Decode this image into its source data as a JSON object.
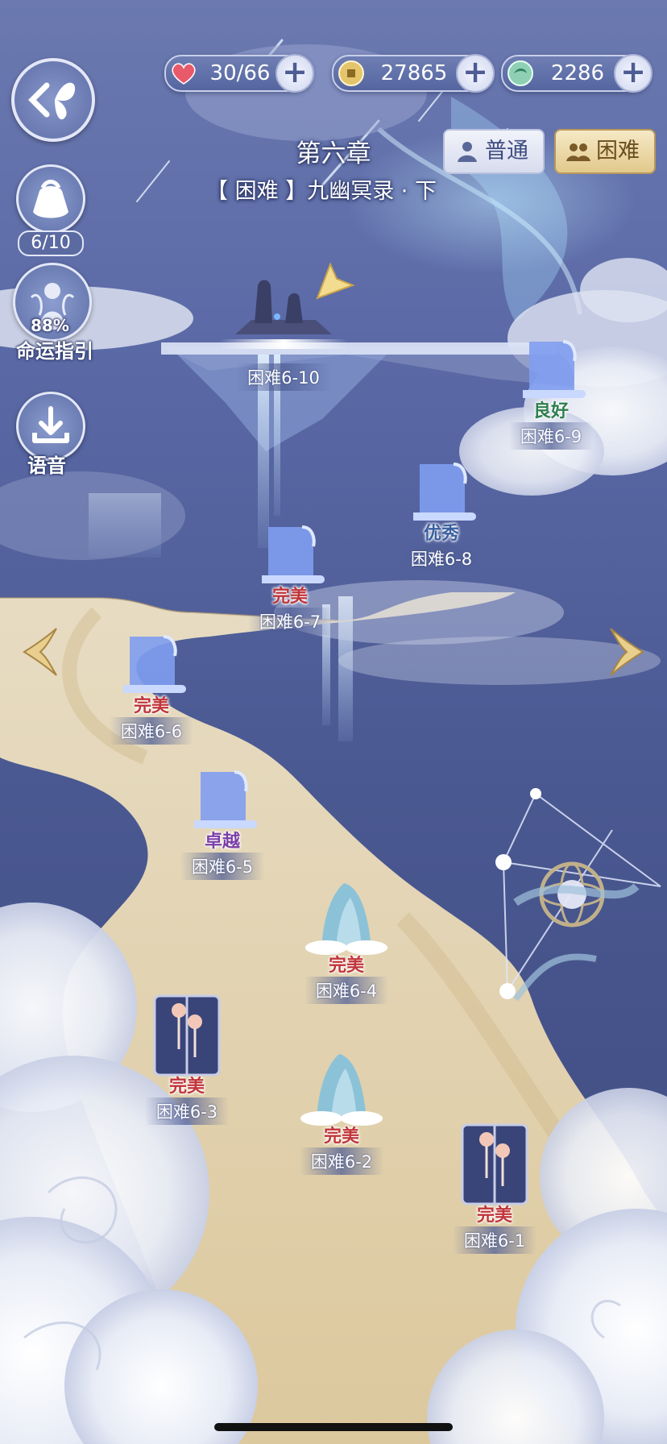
{
  "resources": {
    "stamina": {
      "value": "30/66",
      "icon": "heart-icon",
      "color": "#e8596a"
    },
    "coins": {
      "value": "27865",
      "icon": "coin-icon",
      "color": "#d9b65a"
    },
    "gems": {
      "value": "2286",
      "icon": "jade-icon",
      "color": "#7fc3a8"
    }
  },
  "chapter": {
    "title": "第六章",
    "subtitle": "【 困难 】九幽冥录 · 下"
  },
  "modes": {
    "normal": "普通",
    "hard": "困难",
    "selected": "hard"
  },
  "side": {
    "bag_count": "6/10",
    "fate_percent": "88%",
    "fate_label": "命运指引",
    "voice_label": "语音"
  },
  "stages": [
    {
      "name": "困难6-10",
      "grade": "",
      "type": "mountain-peak"
    },
    {
      "name": "困难6-9",
      "grade": "良好",
      "type": "scroll"
    },
    {
      "name": "困难6-8",
      "grade": "优秀",
      "type": "scroll"
    },
    {
      "name": "困难6-7",
      "grade": "完美",
      "type": "scroll"
    },
    {
      "name": "困难6-6",
      "grade": "完美",
      "type": "scroll"
    },
    {
      "name": "困难6-5",
      "grade": "卓越",
      "type": "scroll"
    },
    {
      "name": "困难6-4",
      "grade": "完美",
      "type": "mountain"
    },
    {
      "name": "困难6-3",
      "grade": "完美",
      "type": "gate"
    },
    {
      "name": "困难6-2",
      "grade": "完美",
      "type": "mountain"
    },
    {
      "name": "困难6-1",
      "grade": "完美",
      "type": "gate"
    }
  ],
  "grade_colors": {
    "完美": "#c0353a",
    "卓越": "#7b3fa8",
    "优秀": "#3a5fa0",
    "良好": "#2f7f4e"
  }
}
